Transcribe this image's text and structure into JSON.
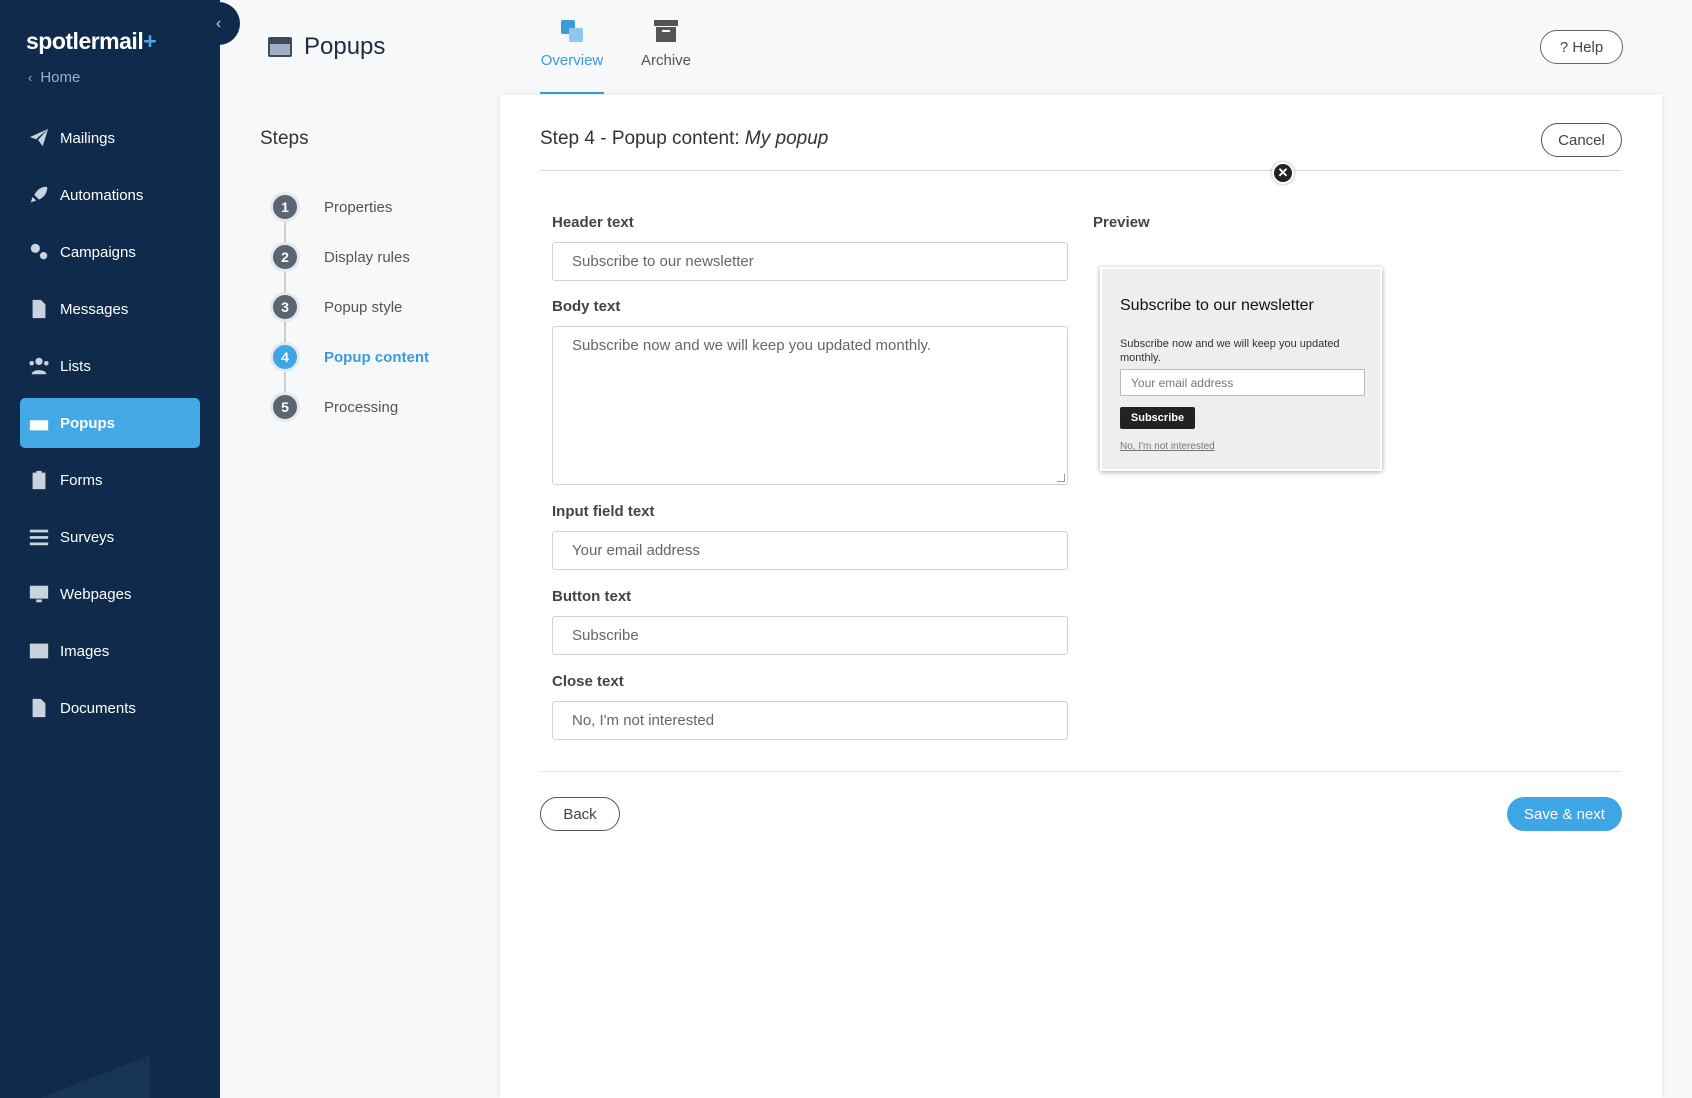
{
  "sidebar": {
    "logo": {
      "main": "spotlermail",
      "plus": "+"
    },
    "home_label": "Home",
    "collapse_icon": "‹",
    "items": [
      {
        "label": "Mailings",
        "icon": "paper-plane-icon"
      },
      {
        "label": "Automations",
        "icon": "rocket-icon"
      },
      {
        "label": "Campaigns",
        "icon": "gears-icon"
      },
      {
        "label": "Messages",
        "icon": "file-icon"
      },
      {
        "label": "Lists",
        "icon": "users-icon"
      },
      {
        "label": "Popups",
        "icon": "window-icon",
        "active": true
      },
      {
        "label": "Forms",
        "icon": "clipboard-icon"
      },
      {
        "label": "Surveys",
        "icon": "sliders-icon"
      },
      {
        "label": "Webpages",
        "icon": "monitor-icon"
      },
      {
        "label": "Images",
        "icon": "image-icon"
      },
      {
        "label": "Documents",
        "icon": "document-icon"
      }
    ]
  },
  "header": {
    "title": "Popups",
    "tabs": [
      {
        "label": "Overview",
        "active": true
      },
      {
        "label": "Archive",
        "active": false
      }
    ],
    "help_label": "? Help"
  },
  "steps": {
    "title": "Steps",
    "items": [
      {
        "num": "1",
        "label": "Properties"
      },
      {
        "num": "2",
        "label": "Display rules"
      },
      {
        "num": "3",
        "label": "Popup style"
      },
      {
        "num": "4",
        "label": "Popup content",
        "active": true
      },
      {
        "num": "5",
        "label": "Processing"
      }
    ]
  },
  "panel": {
    "title_prefix": "Step 4 - Popup content: ",
    "title_name": "My popup",
    "cancel_label": "Cancel",
    "fields": {
      "header_label": "Header text",
      "header_value": "Subscribe to our newsletter",
      "body_label": "Body text",
      "body_value": "Subscribe now and we will keep you updated monthly.",
      "input_label": "Input field text",
      "input_value": "Your email address",
      "button_label": "Button text",
      "button_value": "Subscribe",
      "close_label": "Close text",
      "close_value": "No, I'm not interested"
    },
    "preview": {
      "label": "Preview",
      "title": "Subscribe to our newsletter",
      "body": "Subscribe now and we will keep you updated monthly.",
      "input_placeholder": "Your email address",
      "button": "Subscribe",
      "close_link": "No, I'm not interested",
      "close_x": "✕"
    },
    "back_label": "Back",
    "save_label": "Save & next"
  },
  "colors": {
    "sidebar_bg": "#0f2a4a",
    "accent": "#3ea6e5",
    "active_tab": "#3a9bd9"
  }
}
